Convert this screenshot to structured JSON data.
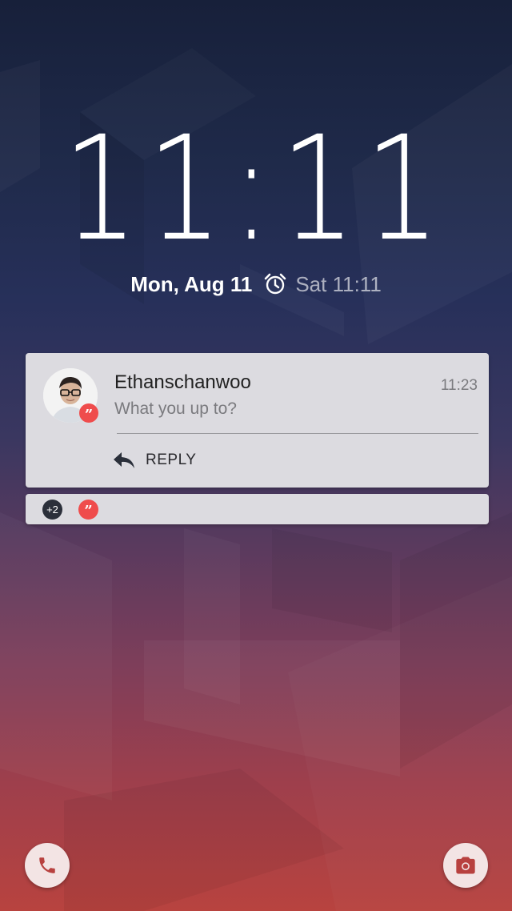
{
  "lockscreen": {
    "clock": "11:11",
    "date": "Mon, Aug 11",
    "alarm": "Sat 11:11"
  },
  "notification": {
    "sender": "Ethanschanwoo",
    "time": "11:23",
    "message": "What you up to?",
    "reply_label": "REPLY",
    "app_icon": "hangouts-quote-icon"
  },
  "summary": {
    "more_count": "+2",
    "app_icon": "hangouts-quote-icon"
  },
  "shortcuts": {
    "left_icon": "phone-icon",
    "right_icon": "camera-icon"
  },
  "colors": {
    "accent": "#ef4c4c",
    "card": "#dcdbe0"
  }
}
